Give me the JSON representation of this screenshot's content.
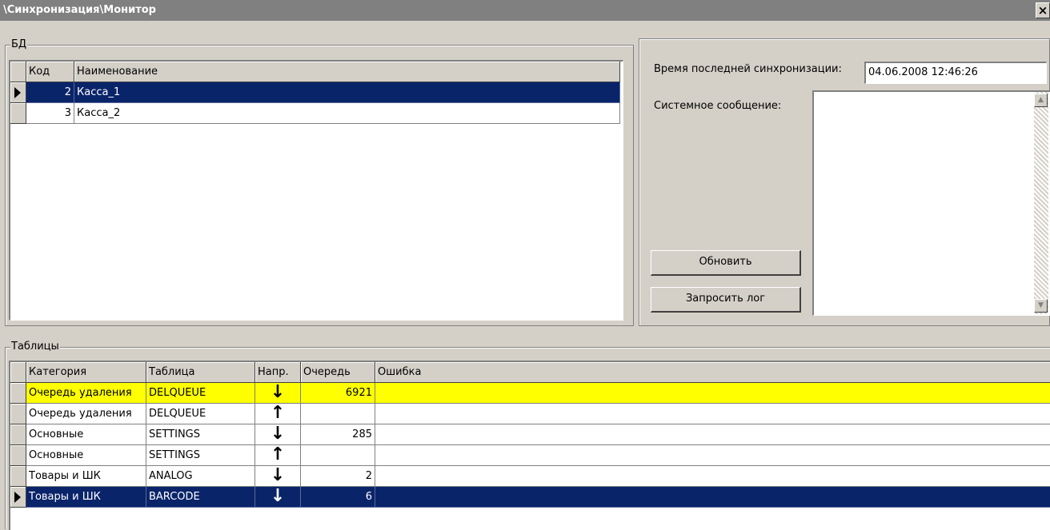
{
  "window": {
    "title": "\\Синхронизация\\Монитор",
    "close_glyph": "×"
  },
  "db_group": {
    "label": "БД",
    "columns": [
      "Код",
      "Наименование"
    ],
    "rows": [
      {
        "code": "2",
        "name": "Касса_1",
        "selected": true
      },
      {
        "code": "3",
        "name": "Касса_2",
        "selected": false
      }
    ]
  },
  "sync_panel": {
    "last_sync_label": "Время последней синхронизации:",
    "last_sync_value": "04.06.2008 12:46:26",
    "system_message_label": "Системное сообщение:",
    "system_message_value": "",
    "refresh_button": "Обновить",
    "request_log_button": "Запросить лог"
  },
  "tables_group": {
    "label": "Таблицы",
    "columns": [
      "Категория",
      "Таблица",
      "Напр.",
      "Очередь",
      "Ошибка"
    ],
    "rows": [
      {
        "category": "Очередь удаления",
        "table": "DELQUEUE",
        "direction": "down-arrow-icon",
        "queue": "6921",
        "error": "",
        "highlight": "yellow"
      },
      {
        "category": "Очередь удаления",
        "table": "DELQUEUE",
        "direction": "up-arrow-icon",
        "queue": "",
        "error": "",
        "highlight": ""
      },
      {
        "category": "Основные",
        "table": "SETTINGS",
        "direction": "down-arrow-icon",
        "queue": "285",
        "error": "",
        "highlight": ""
      },
      {
        "category": "Основные",
        "table": "SETTINGS",
        "direction": "up-arrow-icon",
        "queue": "",
        "error": "",
        "highlight": ""
      },
      {
        "category": "Товары и ШК",
        "table": "ANALOG",
        "direction": "down-arrow-icon",
        "queue": "2",
        "error": "",
        "highlight": ""
      },
      {
        "category": "Товары и ШК",
        "table": "BARCODE",
        "direction": "down-arrow-icon",
        "queue": "6",
        "error": "",
        "highlight": "selected"
      }
    ]
  },
  "colors": {
    "selection": "#0a246a",
    "highlight_yellow": "#ffff00",
    "face": "#d4d0c8"
  }
}
